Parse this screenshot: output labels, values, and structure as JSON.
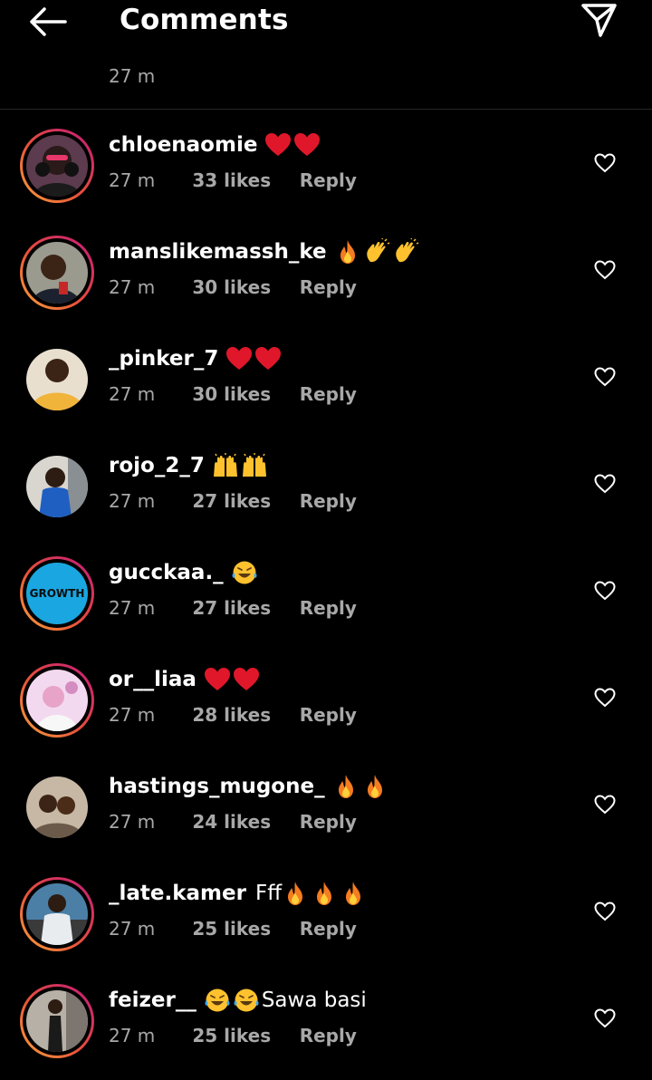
{
  "header": {
    "title": "Comments",
    "back_icon": "back-arrow-icon",
    "send_icon": "paper-plane-icon"
  },
  "previous_comment": {
    "time": "27 m"
  },
  "colors": {
    "background": "#000000",
    "text": "#ffffff",
    "meta_text": "#a8a8a8",
    "story_ring_start": "#f9a43a",
    "story_ring_end": "#c2187d"
  },
  "comments": [
    {
      "username": "chloenaomie",
      "emojis": [
        "heart",
        "heart"
      ],
      "text": "",
      "time": "27 m",
      "likes": "33 likes",
      "reply": "Reply",
      "story_ring": true
    },
    {
      "username": "manslikemassh_ke",
      "emojis": [
        "fire",
        "clap",
        "clap"
      ],
      "text": "",
      "time": "27 m",
      "likes": "30 likes",
      "reply": "Reply",
      "story_ring": true
    },
    {
      "username": "_pinker_7",
      "emojis": [
        "heart",
        "heart"
      ],
      "text": "",
      "time": "27 m",
      "likes": "30 likes",
      "reply": "Reply",
      "story_ring": false
    },
    {
      "username": "rojo_2_7",
      "emojis": [
        "raised-hands",
        "raised-hands"
      ],
      "text": "",
      "time": "27 m",
      "likes": "27 likes",
      "reply": "Reply",
      "story_ring": false
    },
    {
      "username": "gucckaa._",
      "emojis": [
        "laugh-cry"
      ],
      "text": "",
      "time": "27 m",
      "likes": "27 likes",
      "reply": "Reply",
      "story_ring": true,
      "avatar_label": "GROWTH"
    },
    {
      "username": "or__liaa",
      "emojis": [
        "heart",
        "heart"
      ],
      "text": "",
      "time": "27 m",
      "likes": "28 likes",
      "reply": "Reply",
      "story_ring": true
    },
    {
      "username": "hastings_mugone_",
      "emojis": [
        "fire",
        "fire"
      ],
      "text": "",
      "time": "27 m",
      "likes": "24 likes",
      "reply": "Reply",
      "story_ring": false
    },
    {
      "username": "_late.kamer",
      "emojis": [],
      "text": "Fff",
      "trailing_emojis": [
        "fire",
        "fire",
        "fire"
      ],
      "time": "27 m",
      "likes": "25 likes",
      "reply": "Reply",
      "story_ring": true
    },
    {
      "username": "feizer__",
      "emojis": [
        "laugh-cry",
        "laugh-cry"
      ],
      "text": "",
      "trailing_text": "Sawa basi",
      "time": "27 m",
      "likes": "25 likes",
      "reply": "Reply",
      "story_ring": true
    }
  ]
}
